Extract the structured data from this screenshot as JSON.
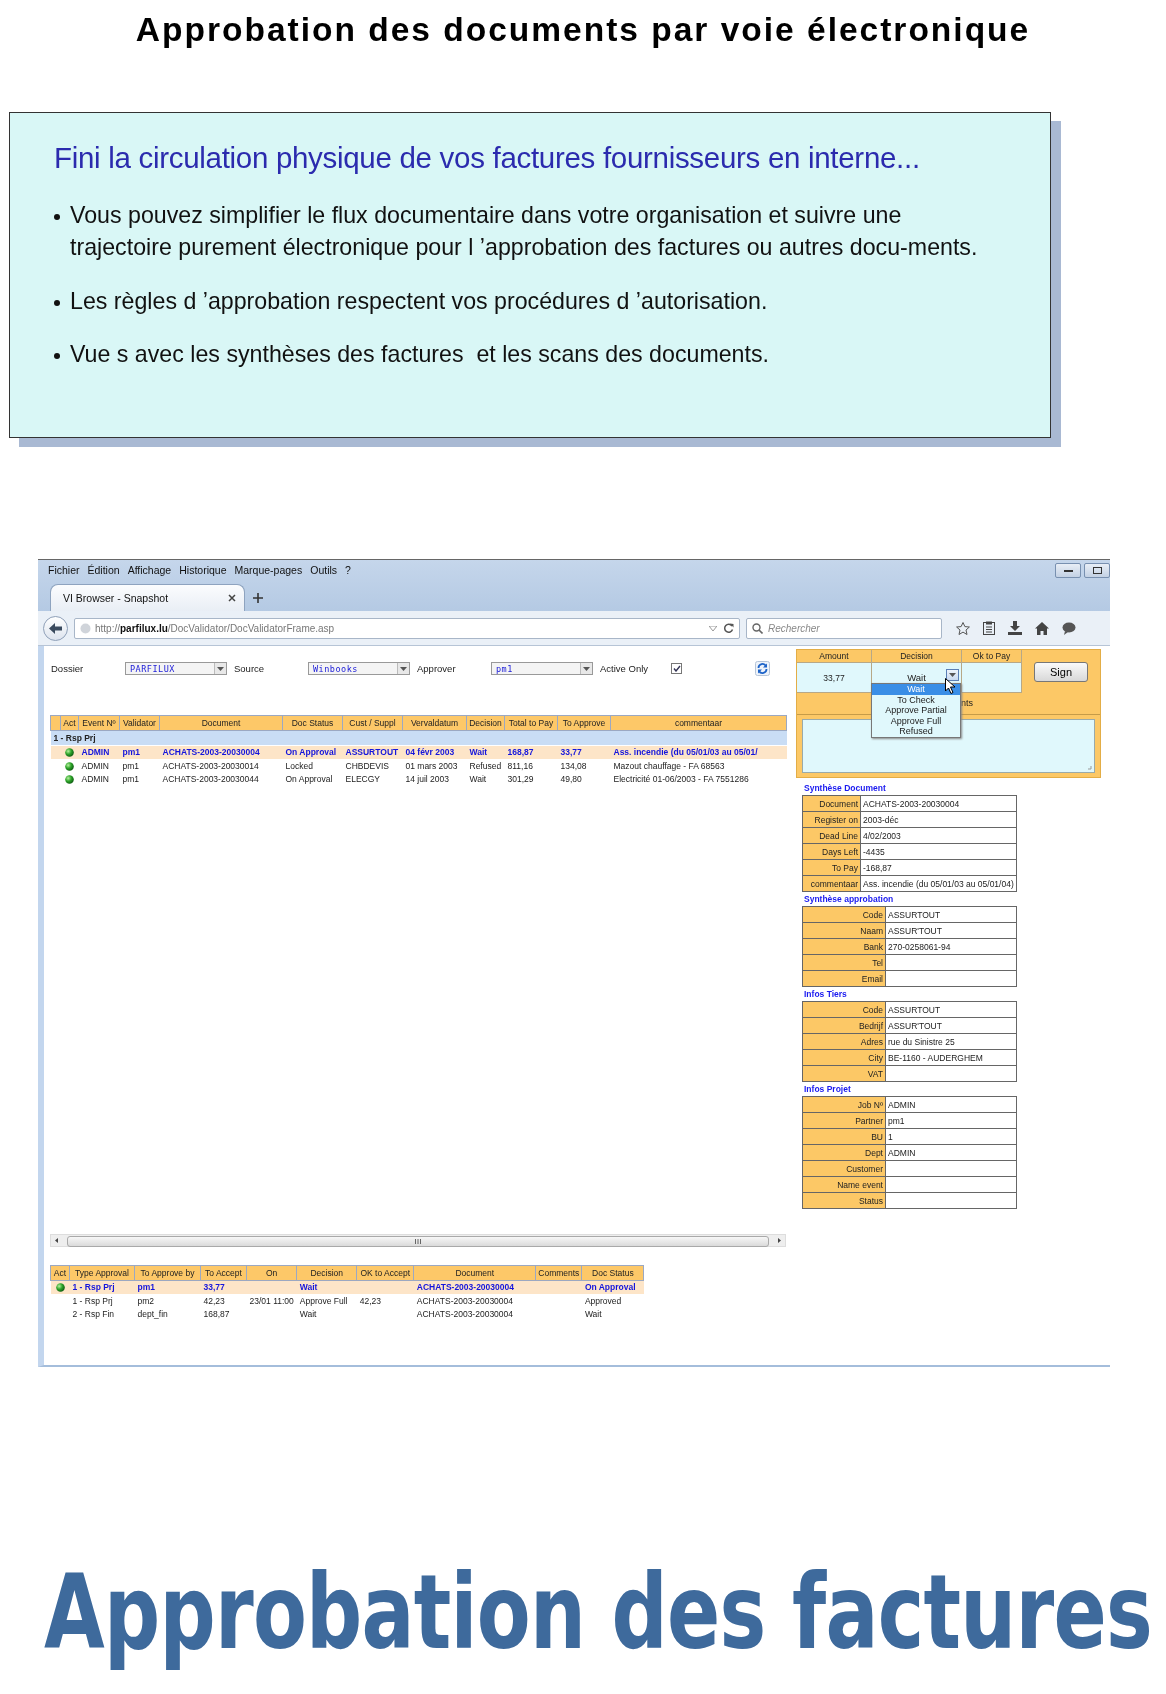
{
  "page_title": "Approbation des documents par voie électronique",
  "intro": {
    "heading": "Fini la circulation physique de vos factures fournisseurs en interne...",
    "bullets": [
      "Vous pouvez simplifier le flux documentaire dans votre organisation et suivre une trajectoire purement électronique pour l ’approbation des factures ou autres docu-ments.",
      "Les règles d ’approbation respectent vos procédures d ’autorisation.",
      "Vue s avec les synthèses des factures  et les scans des documents."
    ]
  },
  "browser": {
    "menu": [
      "Fichier",
      "Édition",
      "Affichage",
      "Historique",
      "Marque-pages",
      "Outils",
      "?"
    ],
    "tab_title": "VI Browser - Snapshot",
    "url": "http://**parfilux.lu**/DocValidator/DocValidatorFrame.asp",
    "search_placeholder": "Rechercher"
  },
  "filters": [
    {
      "label": "Dossier",
      "value": "PARFILUX"
    },
    {
      "label": "Source",
      "value": "Winbooks"
    },
    {
      "label": "Approver",
      "value": "pm1"
    }
  ],
  "active_only": {
    "label": "Active Only",
    "checked": true
  },
  "events": {
    "columns": [
      "Act",
      "Event Nº",
      "Validator",
      "Document",
      "Doc Status",
      "Cust / Suppl",
      "Vervaldatum",
      "Decision",
      "Total to Pay",
      "To Approve",
      "commentaar"
    ],
    "group": "1 - Rsp Prj",
    "rows": [
      {
        "selected": true,
        "active": true,
        "cells": [
          null,
          "ADMIN",
          "pm1",
          "ACHATS-2003-20030004",
          "On Approval",
          "ASSURTOUT",
          "04 févr 2003",
          "Wait",
          "168,87",
          "33,77",
          "Ass. incendie (du 05/01/03 au 05/01/"
        ]
      },
      {
        "selected": false,
        "active": true,
        "cells": [
          null,
          "ADMIN",
          "pm1",
          "ACHATS-2003-20030014",
          "Locked",
          "CHBDEVIS",
          "01 mars 2003",
          "Refused",
          "811,16",
          "134,08",
          "Mazout chauffage - FA 68563"
        ]
      },
      {
        "selected": false,
        "active": true,
        "cells": [
          null,
          "ADMIN",
          "pm1",
          "ACHATS-2003-20030044",
          "On Approval",
          "ELECGY",
          "14 juil 2003",
          "Wait",
          "301,29",
          "49,80",
          "Electricité 01-06/2003 - FA 7551286"
        ]
      }
    ]
  },
  "approvals": {
    "columns": [
      "Act",
      "Type Approval",
      "To Approve by",
      "To Accept",
      "On",
      "Decision",
      "OK to Accept",
      "Document",
      "Comments",
      "Doc Status"
    ],
    "rows": [
      {
        "selected": true,
        "active": true,
        "cells": [
          null,
          "1 - Rsp Prj",
          "pm1",
          "33,77",
          null,
          "Wait",
          null,
          "ACHATS-2003-20030004",
          null,
          "On Approval"
        ]
      },
      {
        "selected": false,
        "active": false,
        "cells": [
          null,
          "1 - Rsp Prj",
          "pm2",
          "42,23",
          "23/01 11:00",
          "Approve Full",
          "42,23",
          "ACHATS-2003-20030004",
          null,
          "Approved"
        ]
      },
      {
        "selected": false,
        "active": false,
        "cells": [
          null,
          "2 - Rsp Fin",
          "dept_fin",
          "168,87",
          null,
          "Wait",
          null,
          "ACHATS-2003-20030004",
          null,
          "Wait"
        ]
      }
    ]
  },
  "decision_panel": {
    "columns": [
      "Amount",
      "Decision",
      "Ok to Pay"
    ],
    "amount": "33,77",
    "decision": "Wait",
    "sign_button": "Sign",
    "comments_label": "nts",
    "options": [
      {
        "label": "Wait",
        "selected": true
      },
      {
        "label": "To Check",
        "selected": false
      },
      {
        "label": "Approve Partial",
        "selected": false
      },
      {
        "label": "Approve Full",
        "selected": false
      },
      {
        "label": "Refused",
        "selected": false
      }
    ]
  },
  "sections": [
    {
      "title": "Synthèse Document",
      "fields": [
        {
          "label": "Document",
          "value": "ACHATS-2003-20030004"
        },
        {
          "label": "Register on",
          "value": "2003-déc"
        },
        {
          "label": "Dead Line",
          "value": "4/02/2003"
        },
        {
          "label": "Days Left",
          "value": "-4435"
        },
        {
          "label": "To Pay",
          "value": "-168,87"
        },
        {
          "label": "commentaar",
          "value": "Ass. incendie (du 05/01/03 au 05/01/04)"
        }
      ]
    },
    {
      "title": "Synthèse approbation",
      "fields": [
        {
          "label": "Code",
          "value": "ASSURTOUT"
        },
        {
          "label": "Naam",
          "value": "ASSUR'TOUT"
        },
        {
          "label": "Bank",
          "value": "270-0258061-94"
        },
        {
          "label": "Tel"
        },
        {
          "label": "Email"
        }
      ]
    },
    {
      "title": "Infos Tiers",
      "fields": [
        {
          "label": "Code",
          "value": "ASSURTOUT"
        },
        {
          "label": "Bedrijf",
          "value": "ASSUR'TOUT"
        },
        {
          "label": "Adres",
          "value": "rue du Sinistre 25"
        },
        {
          "label": "City",
          "value": "BE-1160 - AUDERGHEM"
        },
        {
          "label": "VAT"
        }
      ]
    },
    {
      "title": "Infos Projet",
      "fields": [
        {
          "label": "Job Nº",
          "value": "ADMIN"
        },
        {
          "label": "Partner",
          "value": "pm1"
        },
        {
          "label": "BU",
          "value": "1"
        },
        {
          "label": "Dept",
          "value": "ADMIN"
        },
        {
          "label": "Customer"
        },
        {
          "label": "Name event"
        },
        {
          "label": "Status"
        }
      ]
    }
  ],
  "footer_title": "Approbation des factures"
}
